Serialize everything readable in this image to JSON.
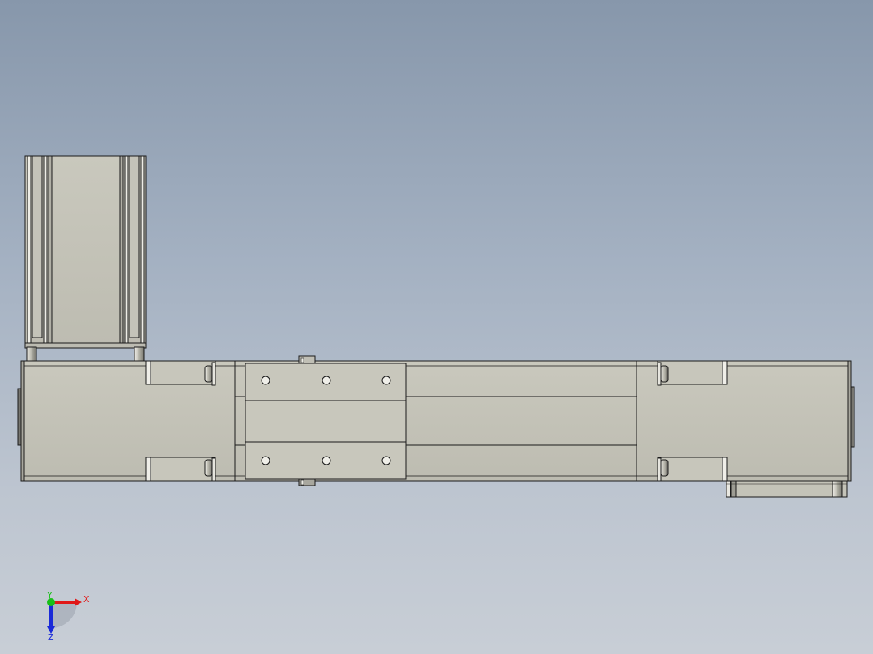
{
  "viewport": {
    "background_top": "#8797ab",
    "background_bottom": "#c8ced6"
  },
  "model": {
    "body_color": "#c2c1b6",
    "edge_color": "#1a1a1a",
    "highlight_color": "#efeee6"
  },
  "triad": {
    "x_label": "X",
    "y_label": "Y",
    "z_label": "Z",
    "x_color": "#e01818",
    "y_color": "#18c018",
    "z_color": "#1a2ad8"
  }
}
